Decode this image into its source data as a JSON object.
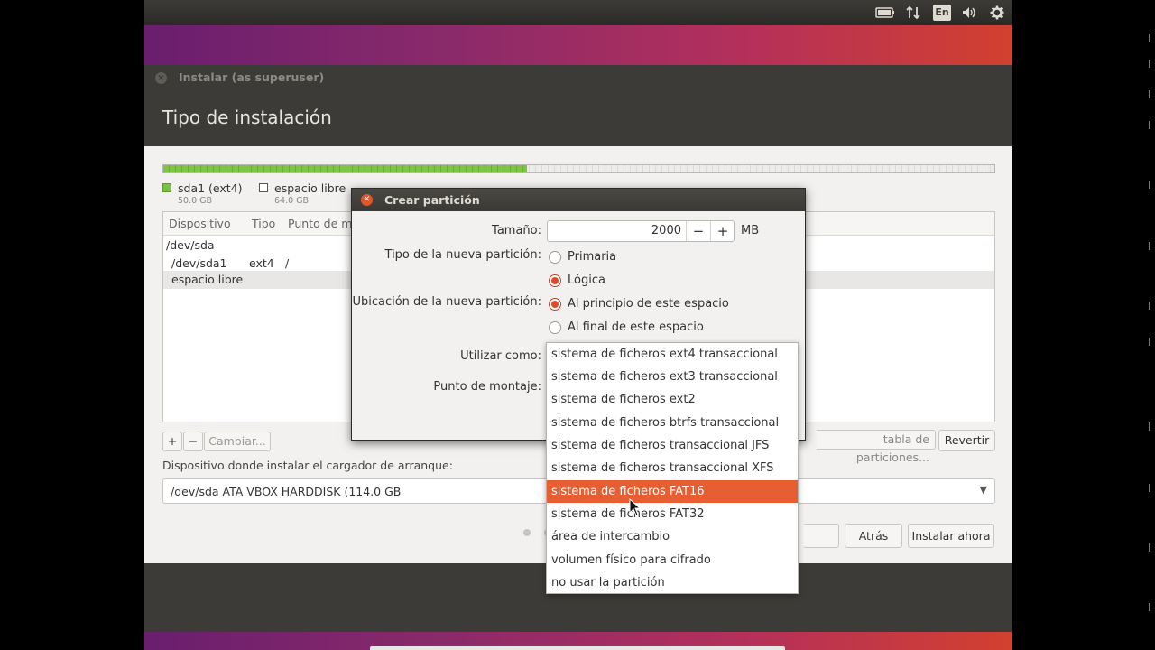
{
  "topbar": {
    "keyboard_layout": "En"
  },
  "installer": {
    "window_title": "Instalar (as superuser)",
    "page_heading": "Tipo de instalación",
    "partition_bar": {
      "used_fraction": 0.438
    },
    "legend": [
      {
        "name": "sda1 (ext4)",
        "size": "50.0 GB",
        "color": "#7bc043"
      },
      {
        "name": "espacio libre",
        "size": "64.0 GB",
        "color": "#ffffff"
      }
    ],
    "table": {
      "headers": [
        "Dispositivo",
        "Tipo",
        "Punto de m"
      ],
      "rows": [
        {
          "device": "/dev/sda",
          "type": "",
          "mount": ""
        },
        {
          "device": "/dev/sda1",
          "type": "ext4",
          "mount": "/"
        },
        {
          "device": "espacio libre",
          "type": "",
          "mount": ""
        }
      ]
    },
    "buttons": {
      "add": "+",
      "remove": "−",
      "change": "Cambiar...",
      "new_table": "tabla de particiones...",
      "revert": "Revertir",
      "back": "Atrás",
      "install_now": "Instalar ahora"
    },
    "bootloader": {
      "label": "Dispositivo donde instalar el cargador de arranque:",
      "value": "/dev/sda   ATA VBOX HARDDISK (114.0 GB"
    },
    "progress_dots": {
      "total": 6,
      "active": 0
    }
  },
  "dialog": {
    "title": "Crear partición",
    "size_label": "Tamaño:",
    "size_value": "2000",
    "size_unit": "MB",
    "minus": "−",
    "plus": "+",
    "type_label": "Tipo de la nueva partición:",
    "type_options": [
      "Primaria",
      "Lógica"
    ],
    "type_selected": "Lógica",
    "location_label": "Ubicación de la nueva partición:",
    "location_options": [
      "Al principio de este espacio",
      "Al final de este espacio"
    ],
    "location_selected": "Al principio de este espacio",
    "use_as_label": "Utilizar como:",
    "mount_label": "Punto de montaje:"
  },
  "dropdown": {
    "items": [
      "sistema de ficheros ext4 transaccional",
      "sistema de ficheros ext3 transaccional",
      "sistema de ficheros ext2",
      "sistema de ficheros btrfs transaccional",
      "sistema de ficheros transaccional JFS",
      "sistema de ficheros transaccional XFS",
      "sistema de ficheros FAT16",
      "sistema de ficheros FAT32",
      "área de intercambio",
      "volumen físico para cifrado",
      "no usar la partición"
    ],
    "highlighted": "sistema de ficheros FAT16"
  },
  "colors": {
    "accent": "#e65e32",
    "partition_used": "#7bc043",
    "dark_chrome": "#3c3b37"
  }
}
